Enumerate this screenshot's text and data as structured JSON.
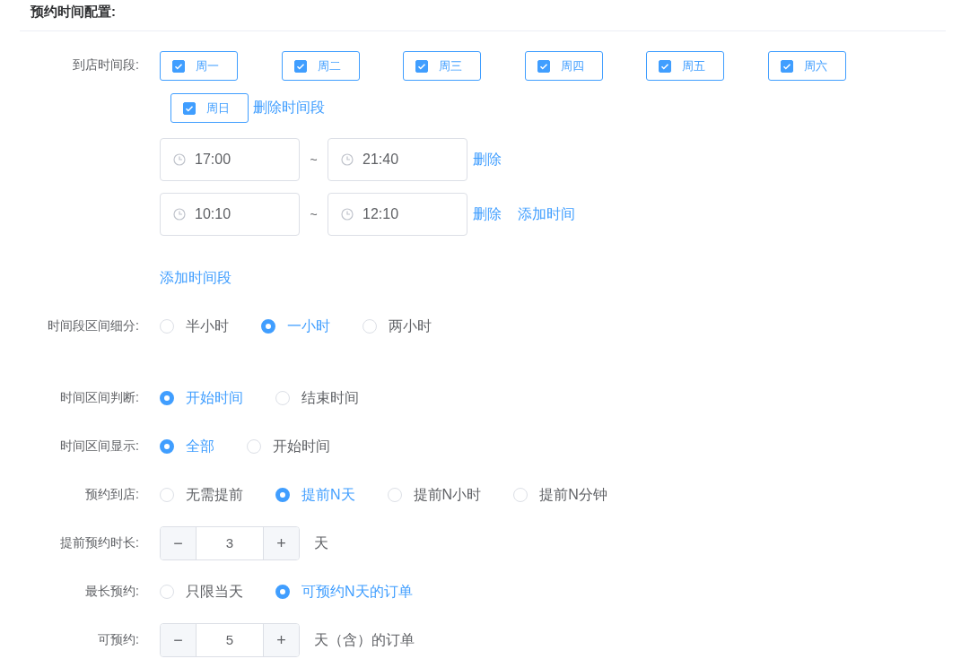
{
  "title": "预约时间配置:",
  "arrival": {
    "label": "到店时间段:",
    "days": [
      {
        "label": "周一",
        "checked": true
      },
      {
        "label": "周二",
        "checked": true
      },
      {
        "label": "周三",
        "checked": true
      },
      {
        "label": "周四",
        "checked": true
      },
      {
        "label": "周五",
        "checked": true
      },
      {
        "label": "周六",
        "checked": true
      },
      {
        "label": "周日",
        "checked": true
      }
    ],
    "delete_link": "删除时间段",
    "time_ranges": [
      {
        "start": "17:00",
        "separator": "~",
        "end": "21:40",
        "actions": [
          "删除"
        ]
      },
      {
        "start": "10:10",
        "separator": "~",
        "end": "12:10",
        "actions": [
          "删除",
          "添加时间"
        ]
      }
    ],
    "add_link": "添加时间段"
  },
  "fields": [
    {
      "kind": "radio",
      "label": "时间段区间细分:",
      "options": [
        {
          "label": "半小时",
          "selected": false
        },
        {
          "label": "一小时",
          "selected": true
        },
        {
          "label": "两小时",
          "selected": false
        }
      ]
    },
    {
      "kind": "radio",
      "label": "时间区间判断:",
      "options": [
        {
          "label": "开始时间",
          "selected": true
        },
        {
          "label": "结束时间",
          "selected": false
        }
      ]
    },
    {
      "kind": "radio",
      "label": "时间区间显示:",
      "options": [
        {
          "label": "全部",
          "selected": true
        },
        {
          "label": "开始时间",
          "selected": false
        }
      ]
    },
    {
      "kind": "radio",
      "label": "预约到店:",
      "options": [
        {
          "label": "无需提前",
          "selected": false
        },
        {
          "label": "提前N天",
          "selected": true
        },
        {
          "label": "提前N小时",
          "selected": false
        },
        {
          "label": "提前N分钟",
          "selected": false
        }
      ]
    },
    {
      "kind": "stepper",
      "label": "提前预约时长:",
      "decrement": "−",
      "value": "3",
      "increment": "+",
      "unit": "天"
    },
    {
      "kind": "radio",
      "label": "最长预约:",
      "options": [
        {
          "label": "只限当天",
          "selected": false
        },
        {
          "label": "可预约N天的订单",
          "selected": true
        }
      ]
    },
    {
      "kind": "stepper",
      "label": "可预约:",
      "decrement": "−",
      "value": "5",
      "increment": "+",
      "unit": "天（含）的订单"
    }
  ]
}
